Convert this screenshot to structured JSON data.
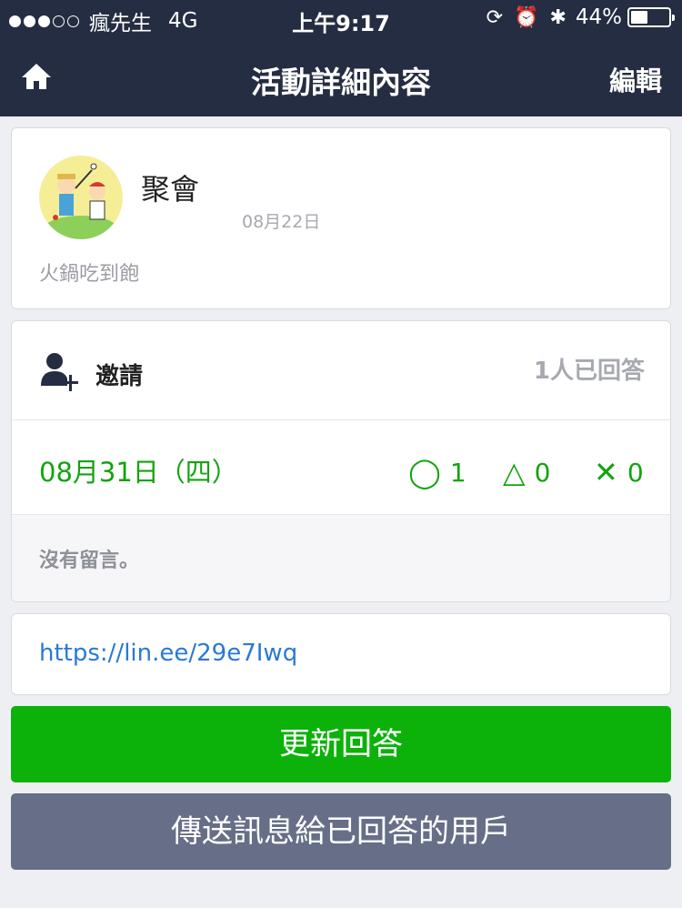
{
  "status_bar": {
    "carrier": "瘋先生",
    "network": "4G",
    "time": "上午9:17",
    "battery_percent": "44%",
    "battery_level": 0.44,
    "signal_bars": 3,
    "icons": [
      "rotation-lock-icon",
      "alarm-icon",
      "bluetooth-icon"
    ]
  },
  "nav": {
    "title": "活動詳細內容",
    "edit_label": "編輯",
    "home_icon": "home-icon"
  },
  "event": {
    "title": "聚會",
    "date": "08月22日",
    "description": "火鍋吃到飽"
  },
  "invite": {
    "label": "邀請",
    "answer_count": "1人已回答"
  },
  "schedule": {
    "date_label": "08月31日（四）",
    "yes_symbol": "◯",
    "yes_count": "1",
    "maybe_symbol": "△",
    "maybe_count": "0",
    "no_symbol": "✕",
    "no_count": "0"
  },
  "comments": {
    "empty_text": "沒有留言。"
  },
  "share": {
    "url": "https://lin.ee/29e7Iwq"
  },
  "buttons": {
    "update_label": "更新回答",
    "send_label": "傳送訊息給已回答的用戶"
  },
  "colors": {
    "header_bg": "#252d42",
    "accent_green": "#0cb20a",
    "send_button_bg": "#666f87",
    "link_blue": "#2a79d6"
  }
}
